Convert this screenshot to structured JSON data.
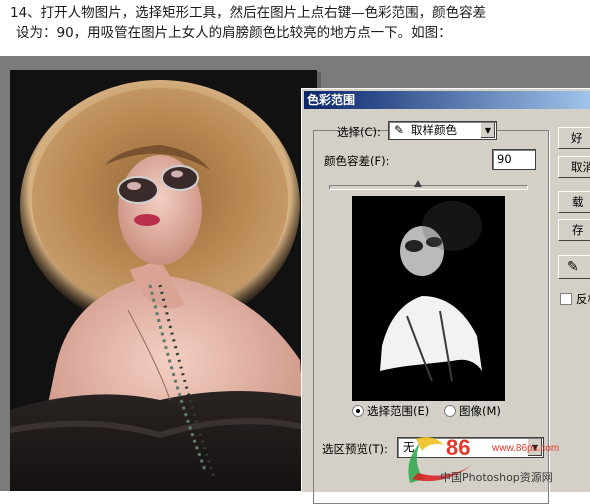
{
  "instruction": {
    "line1": "14、打开人物图片，选择矩形工具，然后在图片上点右键—色彩范围，颜色容差",
    "line2": "设为：90，用吸管在图片上女人的肩膀颜色比较亮的地方点一下。如图："
  },
  "dialog": {
    "title": "色彩范围",
    "select_label": "选择(C):",
    "select_value": "取样颜色",
    "fuzziness_label": "颜色容差(F):",
    "fuzziness_value": "90",
    "fuzziness_level": 0.45,
    "radio_selection": "选择范围(E)",
    "radio_image": "图像(M)",
    "preview_label": "选区预览(T):",
    "preview_value": "无",
    "buttons": {
      "ok": "好",
      "cancel": "取消",
      "load": "载入...",
      "save": "存储..."
    },
    "invert_label": "反相"
  },
  "watermark": {
    "brand": "86",
    "site": "中国Photoshop资源网",
    "url": "www.86ps.com"
  }
}
